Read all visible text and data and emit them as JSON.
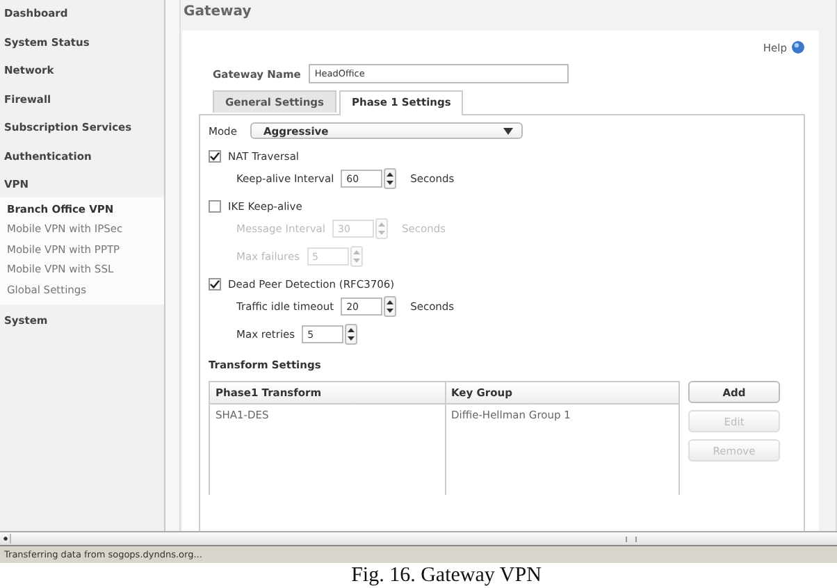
{
  "sidebar": {
    "items": [
      {
        "label": "Dashboard",
        "expanded": false
      },
      {
        "label": "System Status",
        "expanded": false
      },
      {
        "label": "Network",
        "expanded": false
      },
      {
        "label": "Firewall",
        "expanded": false
      },
      {
        "label": "Subscription Services",
        "expanded": false
      },
      {
        "label": "Authentication",
        "expanded": false
      },
      {
        "label": "VPN",
        "expanded": true,
        "children": [
          {
            "label": "Branch Office VPN",
            "selected": true
          },
          {
            "label": "Mobile VPN with IPSec",
            "selected": false
          },
          {
            "label": "Mobile VPN with PPTP",
            "selected": false
          },
          {
            "label": "Mobile VPN with SSL",
            "selected": false
          },
          {
            "label": "Global Settings",
            "selected": false
          }
        ]
      },
      {
        "label": "System",
        "expanded": false
      }
    ]
  },
  "page": {
    "title": "Gateway",
    "help": "Help",
    "gateway_name": {
      "label": "Gateway Name",
      "value": "HeadOffice"
    },
    "tabs": [
      {
        "label": "General Settings",
        "selected": false
      },
      {
        "label": "Phase 1 Settings",
        "selected": true
      }
    ],
    "mode": {
      "label": "Mode",
      "value": "Aggressive"
    },
    "options": [
      {
        "label": "NAT Traversal",
        "checked": true,
        "fields": [
          {
            "label": "Keep-alive Interval",
            "value": "60",
            "unit": "Seconds",
            "disabled": false
          }
        ]
      },
      {
        "label": "IKE Keep-alive",
        "checked": false,
        "fields": [
          {
            "label": "Message Interval",
            "value": "30",
            "unit": "Seconds",
            "disabled": true
          },
          {
            "label": "Max failures",
            "value": "5",
            "disabled": true
          }
        ]
      },
      {
        "label": "Dead Peer Detection (RFC3706)",
        "checked": true,
        "fields": [
          {
            "label": "Traffic idle timeout",
            "value": "20",
            "unit": "Seconds",
            "disabled": false
          },
          {
            "label": "Max retries",
            "value": "5",
            "disabled": false
          }
        ]
      }
    ],
    "transform": {
      "title": "Transform Settings",
      "columns": [
        "Phase1 Transform",
        "Key Group"
      ],
      "rows": [
        [
          "SHA1-DES",
          "Diffie-Hellman Group 1"
        ]
      ],
      "buttons": [
        {
          "label": "Add",
          "disabled": false
        },
        {
          "label": "Edit",
          "disabled": true
        },
        {
          "label": "Remove",
          "disabled": true
        }
      ]
    }
  },
  "status_bar": {
    "text": "Transferring data from sogops.dyndns.org..."
  },
  "caption": "Fig. 16. Gateway VPN"
}
